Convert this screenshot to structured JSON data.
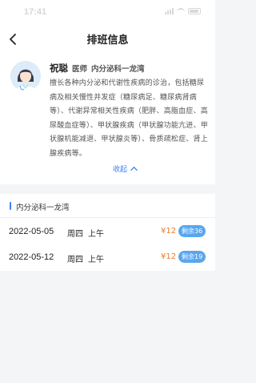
{
  "status_bar": {
    "time": "17:41"
  },
  "nav": {
    "title": "排班信息"
  },
  "doctor": {
    "name": "祝聪",
    "title": "医师",
    "department": "内分泌科一龙湾",
    "description": "擅长各种内分泌和代谢性疾病的诊治，包括糖尿病及相关慢性并发症（糖尿病足、糖尿病肾病等）、代谢异常相关性疾病（肥胖、高脂血症、高尿酸血症等）、甲状腺疾病（甲状腺功能亢进、甲状腺机能减退、甲状腺炎等）、骨质疏松症、肾上腺疾病等。",
    "collapse_label": "收起"
  },
  "schedule": {
    "department": "内分泌科一龙湾",
    "slots": [
      {
        "date": "2022-05-05",
        "weekday": "周四",
        "period": "上午",
        "price": "¥12",
        "remaining": "剩余36"
      },
      {
        "date": "2022-05-12",
        "weekday": "周四",
        "period": "上午",
        "price": "¥12",
        "remaining": "剩余19"
      }
    ]
  },
  "colors": {
    "accent": "#3b82f6",
    "price": "#f07b2c",
    "badge": "#5aa6ee"
  }
}
